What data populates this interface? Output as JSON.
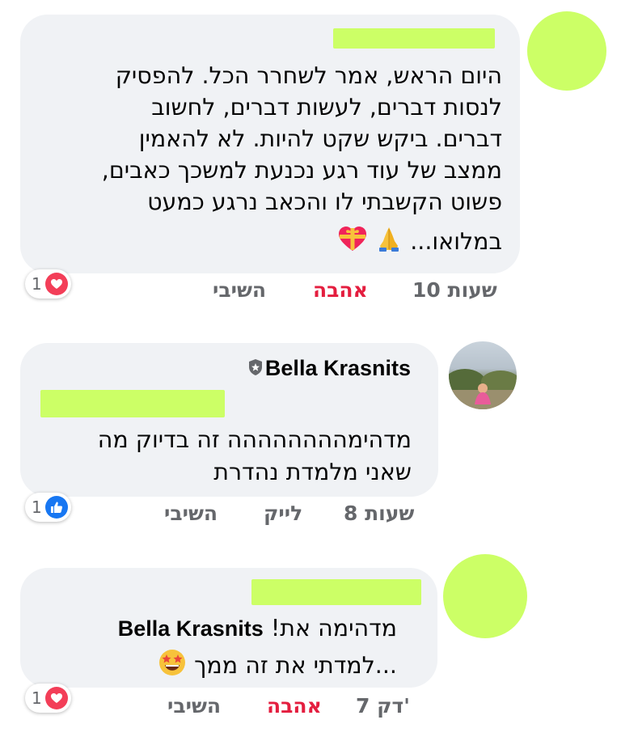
{
  "colors": {
    "redaction": "#ccff66",
    "bubble": "#f0f2f5",
    "love": "#e41e3f",
    "meta": "#65676b",
    "heart_badge": "#f33e58",
    "like_badge": "#1877f2"
  },
  "comments": [
    {
      "lines": [
        "היום הראש, אמר לשחרר הכל. להפסיק",
        "לנסות דברים, לעשות דברים, לחשוב",
        "דברים. ביקש שקט להיות. לא להאמין",
        "ממצב של עוד רגע נכנעת למשכך כאבים,",
        "פשוט הקשבתי לו והכאב נרגע כמעט",
        "במלואו..."
      ],
      "time": "10 שעות",
      "action": "אהבה",
      "reply": "השיבי",
      "reaction_count": "1",
      "reaction_icon": "heart-icon"
    },
    {
      "author": "Bella Krasnits",
      "lines": [
        "מדהימהההההההה זה בדיוק מה",
        "שאני מלמדת נהדרת"
      ],
      "time": "8 שעות",
      "action": "לייק",
      "reply": "השיבי",
      "reaction_count": "1",
      "reaction_icon": "thumbs-up-icon"
    },
    {
      "mention": "Bella Krasnits",
      "line1": "מדהימה את!",
      "line2": "...למדתי את זה ממך",
      "time": "7 דק'",
      "action": "אהבה",
      "reply": "השיבי",
      "reaction_count": "1",
      "reaction_icon": "heart-icon"
    }
  ]
}
